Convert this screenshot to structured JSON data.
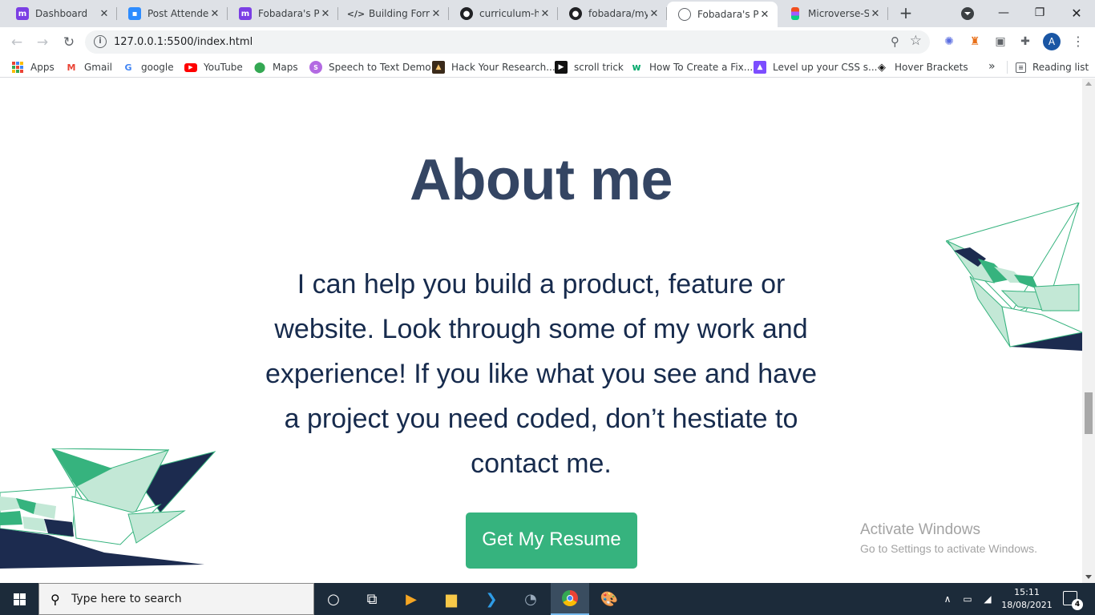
{
  "browser": {
    "tabs": [
      {
        "title": "Dashboard",
        "icon": "microverse-icon",
        "color": "#7b3fe4",
        "active": false
      },
      {
        "title": "Post Attendee",
        "icon": "zoom-icon",
        "color": "#2d8cff",
        "active": false
      },
      {
        "title": "Fobadara's Pr",
        "icon": "microverse-icon",
        "color": "#7b3fe4",
        "active": false
      },
      {
        "title": "Building Form",
        "icon": "code-icon",
        "color": "#3c4043",
        "active": false
      },
      {
        "title": "curriculum-ht",
        "icon": "github-icon",
        "color": "#202124",
        "active": false
      },
      {
        "title": "fobadara/my-",
        "icon": "github-icon",
        "color": "#202124",
        "active": false
      },
      {
        "title": "Fobadara's Po",
        "icon": "globe-icon",
        "color": "#5f6368",
        "active": true
      },
      {
        "title": "Microverse-St",
        "icon": "figma-icon",
        "color": "#f24e1e",
        "active": false
      }
    ],
    "url": "127.0.0.1:5500/index.html",
    "profile_initial": "A",
    "bookmarks": [
      {
        "label": "Apps",
        "icon": "apps-icon"
      },
      {
        "label": "Gmail",
        "icon": "gmail-icon"
      },
      {
        "label": "google",
        "icon": "google-icon"
      },
      {
        "label": "YouTube",
        "icon": "youtube-icon"
      },
      {
        "label": "Maps",
        "icon": "maps-icon"
      },
      {
        "label": "Speech to Text Demo",
        "icon": "speech-icon"
      },
      {
        "label": "Hack Your Research...",
        "icon": "hack-icon"
      },
      {
        "label": "scroll trick",
        "icon": "scroll-icon"
      },
      {
        "label": "How To Create a Fix...",
        "icon": "w3-icon"
      },
      {
        "label": "Level up your CSS s...",
        "icon": "level-icon"
      },
      {
        "label": "Hover Brackets",
        "icon": "codepen-icon"
      }
    ],
    "more_bookmarks": "»",
    "reading_list": "Reading list"
  },
  "page": {
    "heading": "About me",
    "body": "I can help you build a product, feature or website. Look through some of my work and experience! If you like what you see and have a project you need coded, don’t hestiate to contact me.",
    "button_label": "Get My Resume",
    "accent_color": "#36b37e",
    "heading_color": "#344563"
  },
  "watermark": {
    "line1": "Activate Windows",
    "line2": "Go to Settings to activate Windows."
  },
  "taskbar": {
    "search_placeholder": "Type here to search",
    "time": "15:11",
    "date": "18/08/2021",
    "notification_count": "4"
  }
}
